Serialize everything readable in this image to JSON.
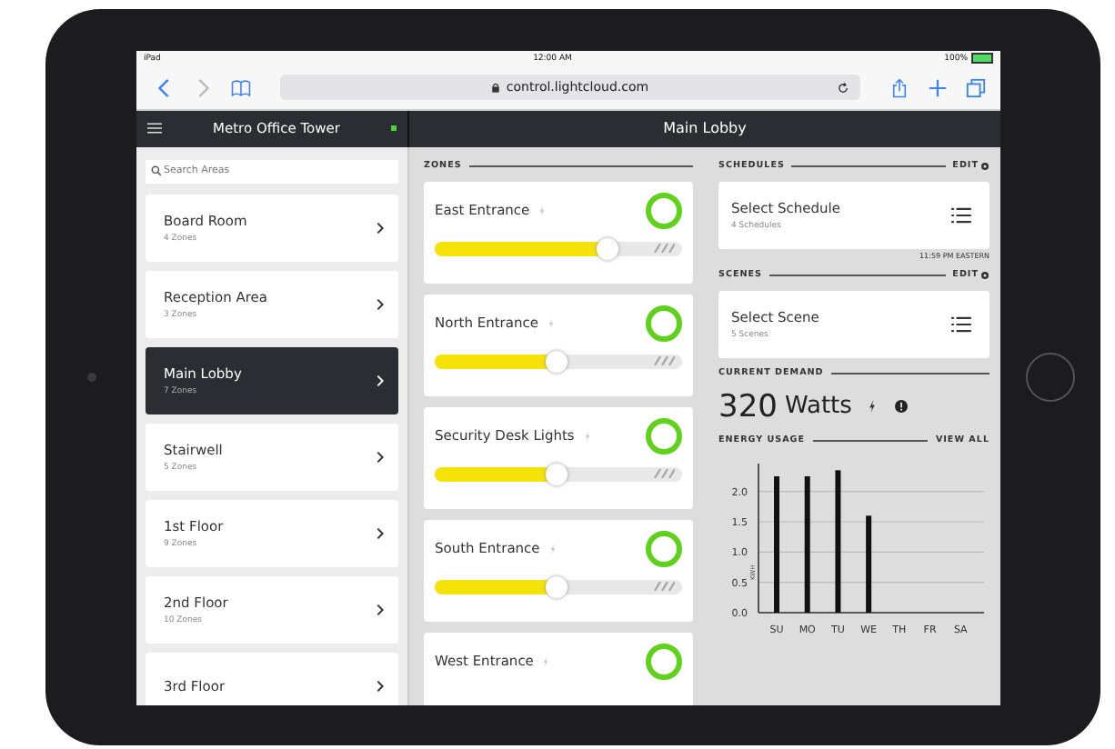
{
  "status_bar": {
    "carrier": "iPad",
    "time": "12:00 AM",
    "battery": "100%"
  },
  "browser": {
    "url": "control.lightcloud.com"
  },
  "sidebar": {
    "title": "Metro Office Tower",
    "online": true,
    "search": {
      "placeholder": "Search Areas"
    },
    "items": [
      {
        "name": "Board Room",
        "zones": "4 Zones",
        "selected": false
      },
      {
        "name": "Reception Area",
        "zones": "3 Zones",
        "selected": false
      },
      {
        "name": "Main Lobby",
        "zones": "7 Zones",
        "selected": true
      },
      {
        "name": "Stairwell",
        "zones": "5 Zones",
        "selected": false
      },
      {
        "name": "1st Floor",
        "zones": "9 Zones",
        "selected": false
      },
      {
        "name": "2nd Floor",
        "zones": "10 Zones",
        "selected": false
      },
      {
        "name": "3rd Floor",
        "selected": false
      }
    ]
  },
  "main": {
    "title": "Main Lobby"
  },
  "zones": {
    "heading": "ZONES",
    "items": [
      {
        "name": "East Entrance",
        "on": true,
        "level": 0.7
      },
      {
        "name": "North Entrance",
        "on": true,
        "level": 0.49
      },
      {
        "name": "Security Desk Lights",
        "on": true,
        "level": 0.49
      },
      {
        "name": "South Entrance",
        "on": true,
        "level": 0.49
      },
      {
        "name": "West Entrance",
        "on": true
      }
    ]
  },
  "schedules": {
    "heading": "SCHEDULES",
    "edit": "EDIT",
    "title": "Select Schedule",
    "count": "4 Schedules",
    "timezone": "11:59 PM EASTERN"
  },
  "scenes": {
    "heading": "SCENES",
    "edit": "EDIT",
    "title": "Select Scene",
    "count": "5 Scenes"
  },
  "demand": {
    "heading": "CURRENT DEMAND",
    "value": "320",
    "unit": "Watts"
  },
  "energy": {
    "heading": "ENERGY USAGE",
    "link": "VIEW ALL",
    "chart_data": {
      "type": "bar",
      "ylabel": "KWH",
      "categories": [
        "SU",
        "MO",
        "TU",
        "WE",
        "TH",
        "FR",
        "SA"
      ],
      "values": [
        2.25,
        2.25,
        2.35,
        1.6,
        null,
        null,
        null
      ],
      "ylim": [
        0,
        2.4
      ],
      "grid": true,
      "yticks": [
        {
          "value": 0,
          "label": "0.0"
        },
        {
          "value": 0.5,
          "label": "0.5"
        },
        {
          "value": 1,
          "label": "1.0"
        },
        {
          "value": 1.5,
          "label": "1.5"
        },
        {
          "value": 2,
          "label": "2.0"
        }
      ]
    }
  }
}
